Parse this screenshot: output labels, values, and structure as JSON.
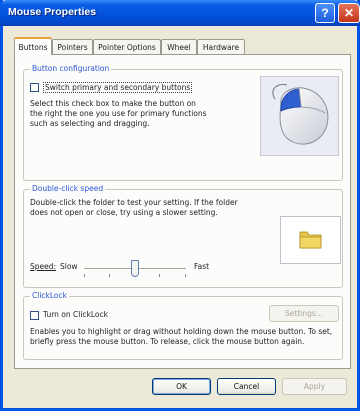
{
  "window": {
    "title": "Mouse Properties",
    "help_glyph": "?",
    "close_glyph": "✕"
  },
  "tabs": [
    {
      "label": "Buttons",
      "active": true
    },
    {
      "label": "Pointers",
      "active": false
    },
    {
      "label": "Pointer Options",
      "active": false
    },
    {
      "label": "Wheel",
      "active": false
    },
    {
      "label": "Hardware",
      "active": false
    }
  ],
  "button_configuration": {
    "legend": "Button configuration",
    "checkbox_label": "Switch primary and secondary buttons",
    "checked": false,
    "description": "Select this check box to make the button on the right the one you use for primary functions such as selecting and dragging."
  },
  "double_click": {
    "legend": "Double-click speed",
    "description": "Double-click the folder to test your setting. If the folder does not open or close, try using a slower setting.",
    "speed_label": "Speed:",
    "slow_label": "Slow",
    "fast_label": "Fast",
    "speed_value": 0.5
  },
  "clicklock": {
    "legend": "ClickLock",
    "checkbox_label": "Turn on ClickLock",
    "checked": false,
    "settings_label": "Settings...",
    "description": "Enables you to highlight or drag without holding down the mouse button. To set, briefly press the mouse button. To release, click the mouse button again."
  },
  "footer": {
    "ok_label": "OK",
    "cancel_label": "Cancel",
    "apply_label": "Apply"
  },
  "colors": {
    "title_blue": "#0553dd",
    "legend_blue": "#2a55d8",
    "close_red": "#c1341a",
    "tab_highlight": "#e9a23a"
  }
}
